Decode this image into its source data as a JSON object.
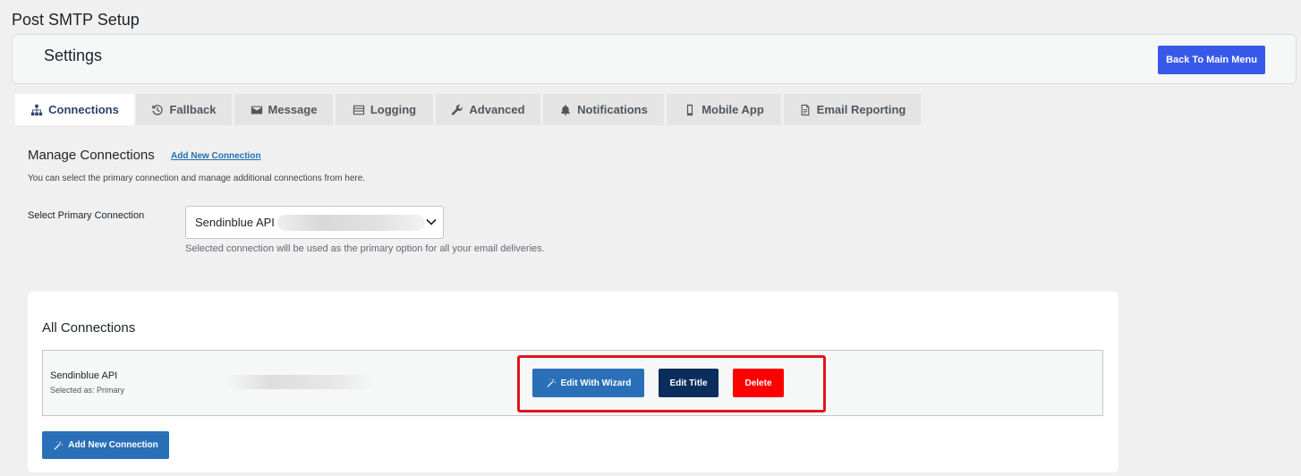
{
  "page": {
    "title": "Post SMTP Setup"
  },
  "header": {
    "title": "Settings",
    "back_label": "Back To Main Menu"
  },
  "tabs": [
    {
      "label": "Connections",
      "icon": "sitemap-icon",
      "active": true
    },
    {
      "label": "Fallback",
      "icon": "history-icon"
    },
    {
      "label": "Message",
      "icon": "envelope-icon"
    },
    {
      "label": "Logging",
      "icon": "list-icon"
    },
    {
      "label": "Advanced",
      "icon": "wrench-icon"
    },
    {
      "label": "Notifications",
      "icon": "bell-icon"
    },
    {
      "label": "Mobile App",
      "icon": "mobile-icon"
    },
    {
      "label": "Email Reporting",
      "icon": "report-icon"
    }
  ],
  "manage": {
    "title": "Manage Connections",
    "add_link": "Add New Connection",
    "description": "You can select the primary connection and manage additional connections from here.",
    "primary_label": "Select Primary Connection",
    "selected_value": "Sendinblue API (",
    "help": "Selected connection will be used as the primary option for all your email deliveries."
  },
  "all_connections": {
    "title": "All Connections",
    "rows": [
      {
        "name": "Sendinblue API",
        "status": "Selected as: Primary"
      }
    ],
    "actions": {
      "wizard": "Edit With Wizard",
      "edit_title": "Edit Title",
      "delete": "Delete"
    },
    "add_button": "Add New Connection"
  },
  "colors": {
    "accent": "#3858e9",
    "primary_button": "#2a70b8",
    "dark_button": "#0a2d5c",
    "delete_button": "#ff0000",
    "highlight": "#e0151d"
  }
}
